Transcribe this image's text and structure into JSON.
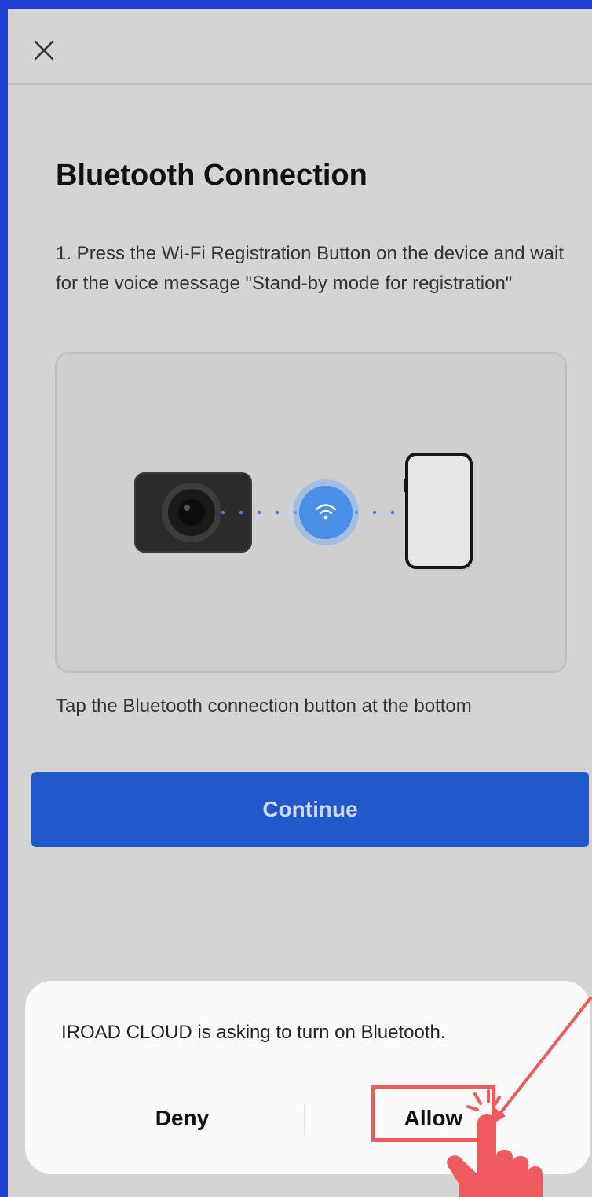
{
  "header": {
    "close_icon": "close-icon"
  },
  "page": {
    "title": "Bluetooth Connection",
    "instruction": "1. Press the Wi-Fi Registration Button on the device and wait for the voice message \"Stand-by mode for registration\"",
    "hint": "Tap the Bluetooth connection button at the bottom",
    "continue_label": "Continue"
  },
  "illustration": {
    "device_icon": "dashcam-icon",
    "signal_icon": "wifi-icon",
    "phone_icon": "smartphone-icon"
  },
  "dialog": {
    "message": "IROAD CLOUD is asking to turn on Bluetooth.",
    "deny_label": "Deny",
    "allow_label": "Allow"
  },
  "colors": {
    "primary": "#2159cc",
    "background": "#d4d4d4",
    "frame": "#1f3fd8",
    "annotation": "#f05a5e"
  }
}
